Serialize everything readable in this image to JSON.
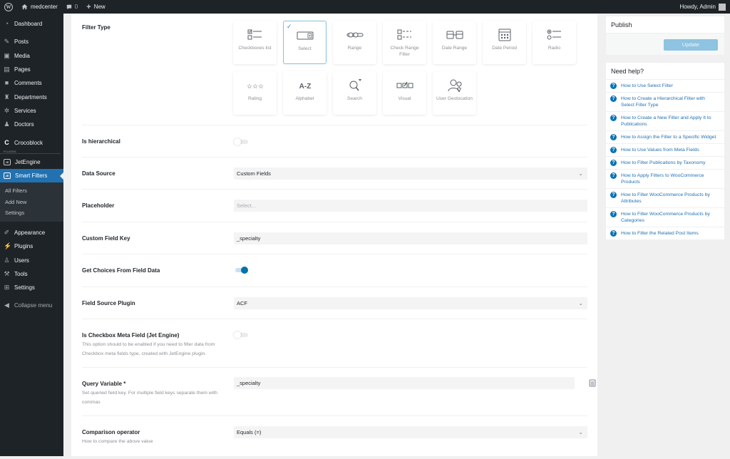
{
  "adminbar": {
    "site_name": "medcenter",
    "comments_count": "0",
    "new_label": "New",
    "greeting": "Howdy, Admin"
  },
  "sidebar": {
    "items_top": [
      {
        "label": "Dashboard",
        "icon": "dashboard-icon"
      }
    ],
    "items_content": [
      {
        "label": "Posts",
        "icon": "pin-icon"
      },
      {
        "label": "Media",
        "icon": "media-icon"
      },
      {
        "label": "Pages",
        "icon": "pages-icon"
      },
      {
        "label": "Comments",
        "icon": "comment-icon"
      },
      {
        "label": "Departments",
        "icon": "building-icon"
      },
      {
        "label": "Services",
        "icon": "gear-icon"
      },
      {
        "label": "Doctors",
        "icon": "user-group-icon"
      }
    ],
    "crocoblock": {
      "label": "Crocoblock",
      "icon": "crocoblock-icon"
    },
    "plugins_tag": "PLUGINS",
    "jetengine": {
      "label": "JetEngine",
      "icon": "jet-icon"
    },
    "smart_filters": {
      "label": "Smart Filters",
      "icon": "jet-icon"
    },
    "submenu": [
      "All Filters",
      "Add New",
      "Settings"
    ],
    "items_bottom": [
      {
        "label": "Appearance",
        "icon": "brush-icon"
      },
      {
        "label": "Plugins",
        "icon": "plug-icon"
      },
      {
        "label": "Users",
        "icon": "user-icon"
      },
      {
        "label": "Tools",
        "icon": "wrench-icon"
      },
      {
        "label": "Settings",
        "icon": "settings-icon"
      }
    ],
    "collapse_label": "Collapse menu"
  },
  "form": {
    "filter_type": {
      "label": "Filter Type",
      "selected": "Select",
      "options": [
        {
          "label": "Checkboxes list",
          "icon": "checkboxes-icon"
        },
        {
          "label": "Select",
          "icon": "select-icon"
        },
        {
          "label": "Range",
          "icon": "range-icon"
        },
        {
          "label": "Check Range Filter",
          "icon": "check-range-icon"
        },
        {
          "label": "Date Range",
          "icon": "date-range-icon"
        },
        {
          "label": "Date Period",
          "icon": "calendar-icon"
        },
        {
          "label": "Radio",
          "icon": "radio-icon"
        },
        {
          "label": "Rating",
          "icon": "stars-icon"
        },
        {
          "label": "Alphabet",
          "icon": "alphabet-icon"
        },
        {
          "label": "Search",
          "icon": "search-icon"
        },
        {
          "label": "Visual",
          "icon": "visual-icon"
        },
        {
          "label": "User Geolocation",
          "icon": "geolocation-icon"
        }
      ]
    },
    "is_hierarchical": {
      "label": "Is hierarchical",
      "enabled": false
    },
    "data_source": {
      "label": "Data Source",
      "value": "Custom Fields"
    },
    "placeholder": {
      "label": "Placeholder",
      "value": "",
      "placeholder": "Select..."
    },
    "custom_field_key": {
      "label": "Custom Field Key",
      "value": "_specialty"
    },
    "get_choices": {
      "label": "Get Choices From Field Data",
      "enabled": true
    },
    "field_source_plugin": {
      "label": "Field Source Plugin",
      "value": "ACF"
    },
    "is_checkbox_meta": {
      "label": "Is Checkbox Meta Field (Jet Engine)",
      "description": "This option should to be enabled if you need to filter data from Checkbox meta fields type, created with JetEngine plugin.",
      "enabled": false
    },
    "query_variable": {
      "label": "Query Variable *",
      "description": "Set queried field key. For multiple field keys separate them with commas",
      "value": "_specialty"
    },
    "comparison_operator": {
      "label": "Comparison operator",
      "description": "How to compare the above value",
      "value": "Equals (=)"
    }
  },
  "publish": {
    "title": "Publish",
    "update_label": "Update"
  },
  "help": {
    "title": "Need help?",
    "links": [
      "How to Use Select Filter",
      "How to Create a Hierarchical Filter with Select Filter Type",
      "How to Create a New Filter and Apply It to Publications",
      "How to Assign the Filter to a Specific Widget",
      "How to Use Values from Meta Fields",
      "How to Filter Publications by Taxonomy",
      "How to Apply Filters to WooCommerce Products",
      "How to Filter WooCommerce Products by Attributes",
      "How to Filter WooCommerce Products by Categories",
      "How to Filter the Related Post Items"
    ]
  },
  "colors": {
    "accent": "#2271b1",
    "toggle_on": "#0073aa",
    "admin_dark": "#1d2327"
  }
}
